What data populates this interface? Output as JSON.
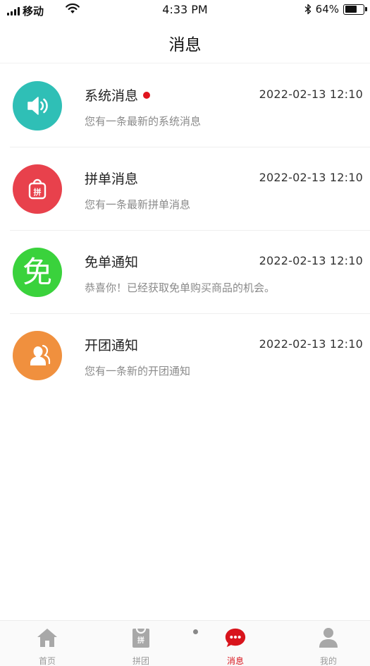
{
  "status_bar": {
    "carrier": "移动",
    "time": "4:33 PM",
    "battery_percent": "64%",
    "battery_level": 0.64
  },
  "header": {
    "title": "消息"
  },
  "colors": {
    "system": "#2fbfb6",
    "group": "#e8414c",
    "free": "#3ad23c",
    "open": "#f0903e",
    "accent": "#d8141c",
    "unread_dot": "#e0141e"
  },
  "messages": [
    {
      "title": "系统消息",
      "time": "2022-02-13  12:10",
      "subtitle": "您有一条最新的系统消息",
      "icon": "speaker-icon",
      "unread": true
    },
    {
      "title": "拼单消息",
      "time": "2022-02-13  12:10",
      "subtitle": "您有一条最新拼单消息",
      "icon": "shopping-bag-icon",
      "icon_text": "拼"
    },
    {
      "title": "免单通知",
      "time": "2022-02-13  12:10",
      "subtitle": "恭喜你！已经获取免单购买商品的机会。",
      "icon": "free-icon",
      "icon_text": "免"
    },
    {
      "title": "开团通知",
      "time": "2022-02-13  12:10",
      "subtitle": "您有一条新的开团通知",
      "icon": "users-icon"
    }
  ],
  "tabs": [
    {
      "label": "首页",
      "icon": "home-icon"
    },
    {
      "label": "拼团",
      "icon": "group-bag-icon",
      "icon_text": "拼"
    },
    {
      "label": "消息",
      "icon": "chat-icon",
      "active": true
    },
    {
      "label": "我的",
      "icon": "person-icon"
    }
  ]
}
